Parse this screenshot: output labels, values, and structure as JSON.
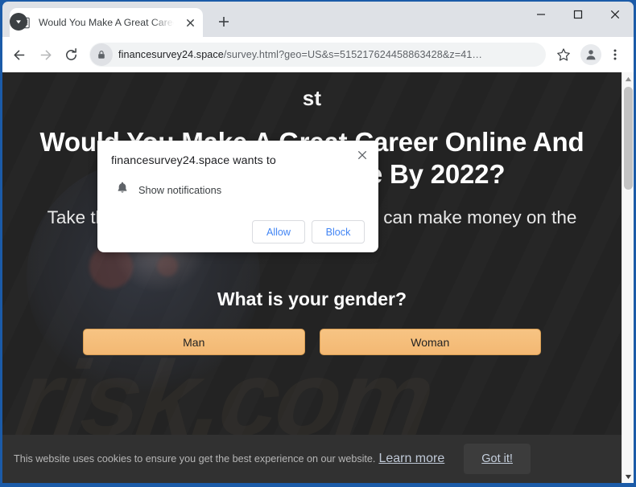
{
  "window": {
    "controls": {
      "download_indicator": "download-indicator",
      "minimize": "minimize",
      "maximize": "maximize",
      "close": "close"
    }
  },
  "tabs": [
    {
      "title": "Would You Make A Great Career",
      "favicon": "document-icon",
      "close_label": "×"
    }
  ],
  "tabstrip": {
    "new_tab_label": "+"
  },
  "toolbar": {
    "back_label": "←",
    "forward_label": "→",
    "reload_label": "⟳",
    "bookmark_label": "☆",
    "menu_label": "⋮",
    "omnibox": {
      "host": "financesurvey24.space",
      "path": "/survey.html?geo=US&s=515217624458863428&z=41…",
      "full_url": "financesurvey24.space/survey.html?geo=US&s=515217624458863428&z=41...",
      "lock_icon": "lock-icon"
    },
    "profile_icon": "profile-avatar-icon"
  },
  "permission_dialog": {
    "title": "financesurvey24.space wants to",
    "permission_icon": "bell-icon",
    "permission_label": "Show notifications",
    "allow_label": "Allow",
    "block_label": "Block",
    "close_label": "×"
  },
  "page": {
    "eyebrow": "st",
    "headline": "Would You Make A Great Career Online And Become A Millionaire By 2022?",
    "subhead": "Take this FREE test and find out how you can make money on the Internet.",
    "question": "What is your gender?",
    "choices": [
      {
        "label": "Man"
      },
      {
        "label": "Woman"
      }
    ],
    "watermark": "risk.com",
    "colors": {
      "background": "#232323",
      "button": "#f4bc78",
      "button_border": "#d99e53",
      "text": "#ffffff"
    }
  },
  "cookie_banner": {
    "text": "This website uses cookies to ensure you get the best experience on our website.",
    "link_label": "Learn more",
    "accept_label": "Got it!"
  },
  "scrollbar": {
    "up_arrow": "▲",
    "down_arrow": "▼"
  }
}
